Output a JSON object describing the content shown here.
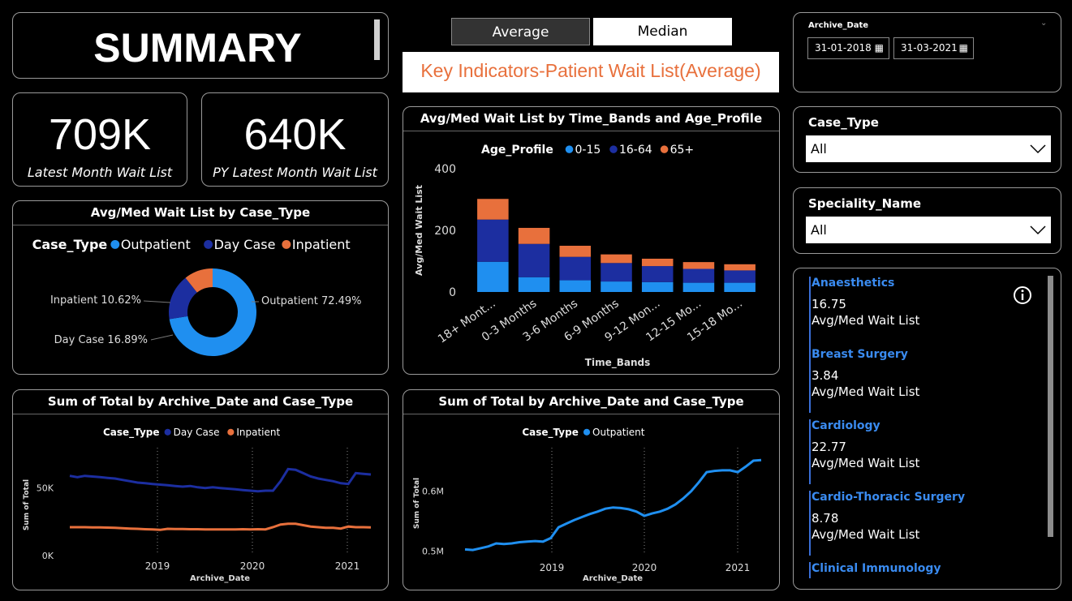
{
  "summary": {
    "title": "SUMMARY"
  },
  "kpis": [
    {
      "value": "709K",
      "label": "Latest Month Wait List"
    },
    {
      "value": "640K",
      "label": "PY Latest Month Wait List"
    }
  ],
  "toggle": {
    "average": "Average",
    "median": "Median"
  },
  "headline": "Key Indicators-Patient Wait List(Average)",
  "colors": {
    "outpatient": "#1f8ff0",
    "daycase": "#1c2ea0",
    "inpatient": "#e8703c",
    "headline": "#e8703c"
  },
  "slicers": {
    "archive_date": {
      "title": "Archive_Date",
      "start": "31-01-2018",
      "end": "31-03-2021"
    },
    "case_type": {
      "title": "Case_Type",
      "value": "All"
    },
    "speciality": {
      "title": "Speciality_Name",
      "value": "All"
    }
  },
  "speciality_list": [
    {
      "name": "Anaesthetics",
      "value": "16.75",
      "label": "Avg/Med Wait List"
    },
    {
      "name": "Breast Surgery",
      "value": "3.84",
      "label": "Avg/Med Wait List"
    },
    {
      "name": "Cardiology",
      "value": "22.77",
      "label": "Avg/Med Wait List"
    },
    {
      "name": "Cardio-Thoracic Surgery",
      "value": "8.78",
      "label": "Avg/Med Wait List"
    },
    {
      "name": "Clinical Immunology",
      "value": "",
      "label": ""
    }
  ],
  "chart_data": [
    {
      "type": "pie",
      "title": "Avg/Med Wait List by Case_Type",
      "legend_title": "Case_Type",
      "legend_position": "top",
      "slices": [
        {
          "name": "Outpatient",
          "value": 72.49,
          "label": "Outpatient 72.49%"
        },
        {
          "name": "Day Case",
          "value": 16.89,
          "label": "Day Case 16.89%"
        },
        {
          "name": "Inpatient",
          "value": 10.62,
          "label": "Inpatient 10.62%"
        }
      ]
    },
    {
      "type": "bar",
      "stacked": true,
      "title": "Avg/Med Wait List by Time_Bands and Age_Profile",
      "legend_title": "Age_Profile",
      "legend_position": "top",
      "xlabel": "Time_Bands",
      "ylabel": "Avg/Med Wait List",
      "ylim": [
        0,
        400
      ],
      "yticks": [
        0,
        200,
        400
      ],
      "categories": [
        "18+ Mont...",
        "0-3 Months",
        "3-6 Months",
        "6-9 Months",
        "9-12 Mon...",
        "12-15 Mo...",
        "15-18 Mo..."
      ],
      "series": [
        {
          "name": "0-15",
          "values": [
            98,
            48,
            38,
            34,
            32,
            30,
            30
          ]
        },
        {
          "name": "16-64",
          "values": [
            137,
            108,
            76,
            60,
            52,
            45,
            40
          ]
        },
        {
          "name": "65+",
          "values": [
            67,
            52,
            36,
            28,
            24,
            22,
            20
          ]
        }
      ]
    },
    {
      "type": "line",
      "title": "Sum of Total by Archive_Date and Case_Type",
      "legend_title": "Case_Type",
      "legend_position": "top",
      "xlabel": "Archive_Date",
      "ylabel": "Sum of Total",
      "xticks": [
        "2019",
        "2020",
        "2021"
      ],
      "yticks": [
        "0K",
        "50K"
      ],
      "ylim": [
        0,
        75000
      ],
      "x": [
        "2018-02",
        "2018-03",
        "2018-04",
        "2018-05",
        "2018-06",
        "2018-07",
        "2018-08",
        "2018-09",
        "2018-10",
        "2018-11",
        "2018-12",
        "2019-01",
        "2019-02",
        "2019-03",
        "2019-04",
        "2019-05",
        "2019-06",
        "2019-07",
        "2019-08",
        "2019-09",
        "2019-10",
        "2019-11",
        "2019-12",
        "2020-01",
        "2020-02",
        "2020-03",
        "2020-04",
        "2020-05",
        "2020-06",
        "2020-07",
        "2020-08",
        "2020-09",
        "2020-10",
        "2020-11",
        "2020-12",
        "2021-01",
        "2021-02",
        "2021-03"
      ],
      "series": [
        {
          "name": "Day Case",
          "values": [
            59000,
            58000,
            59000,
            58500,
            58000,
            57500,
            57000,
            56000,
            55000,
            54000,
            53500,
            53000,
            52500,
            52000,
            51500,
            51000,
            51500,
            50500,
            50000,
            50500,
            50000,
            49500,
            49000,
            48500,
            48000,
            47500,
            48000,
            48000,
            55000,
            64000,
            63500,
            61000,
            58500,
            57000,
            56000,
            55000,
            53500,
            53000,
            61000,
            60500,
            60000
          ]
        },
        {
          "name": "Inpatient",
          "values": [
            21000,
            21000,
            21000,
            20800,
            20800,
            20700,
            20500,
            20200,
            20000,
            19800,
            19500,
            19300,
            19000,
            19800,
            19700,
            19600,
            19500,
            19500,
            19400,
            19400,
            19300,
            19400,
            19400,
            19500,
            19400,
            19500,
            19400,
            21000,
            23000,
            23500,
            23500,
            22500,
            21500,
            21000,
            20500,
            20500,
            20000,
            21500,
            21000,
            21000,
            20800
          ]
        }
      ]
    },
    {
      "type": "line",
      "title": "Sum of Total by Archive_Date and Case_Type",
      "legend_title": "Case_Type",
      "legend_position": "top",
      "xlabel": "Archive_Date",
      "ylabel": "Sum of Total",
      "xticks": [
        "2019",
        "2020",
        "2021"
      ],
      "yticks": [
        "0.5M",
        "0.6M"
      ],
      "ylim": [
        490000,
        670000
      ],
      "x": [
        "2018-02",
        "2018-03",
        "2018-04",
        "2018-05",
        "2018-06",
        "2018-07",
        "2018-08",
        "2018-09",
        "2018-10",
        "2018-11",
        "2018-12",
        "2019-01",
        "2019-02",
        "2019-03",
        "2019-04",
        "2019-05",
        "2019-06",
        "2019-07",
        "2019-08",
        "2019-09",
        "2019-10",
        "2019-11",
        "2019-12",
        "2020-01",
        "2020-02",
        "2020-03",
        "2020-04",
        "2020-05",
        "2020-06",
        "2020-07",
        "2020-08",
        "2020-09",
        "2020-10",
        "2020-11",
        "2020-12",
        "2021-01",
        "2021-02",
        "2021-03"
      ],
      "series": [
        {
          "name": "Outpatient",
          "values": [
            503000,
            502000,
            505000,
            508000,
            513000,
            512000,
            513000,
            515000,
            516000,
            517000,
            516000,
            522000,
            540000,
            546000,
            552000,
            557000,
            562000,
            566000,
            571000,
            573000,
            572000,
            570000,
            566000,
            559000,
            563000,
            566000,
            571000,
            578000,
            588000,
            600000,
            615000,
            632000,
            634000,
            635000,
            635000,
            632000,
            641000,
            651000,
            652000
          ]
        }
      ]
    }
  ]
}
